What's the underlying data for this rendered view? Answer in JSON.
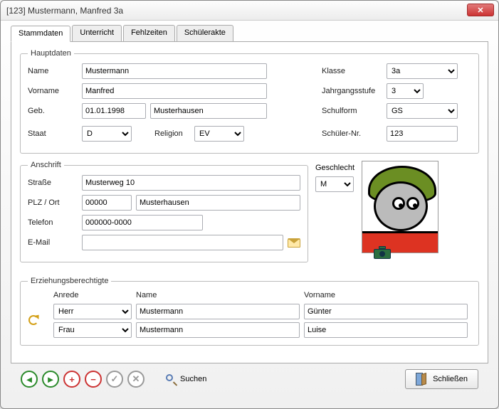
{
  "window": {
    "title": "[123]  Mustermann, Manfred 3a"
  },
  "tabs": {
    "stammdaten": "Stammdaten",
    "unterricht": "Unterricht",
    "fehlzeiten": "Fehlzeiten",
    "schuelerakte": "Schülerakte"
  },
  "hauptdaten": {
    "legend": "Hauptdaten",
    "name_label": "Name",
    "name": "Mustermann",
    "vorname_label": "Vorname",
    "vorname": "Manfred",
    "geb_label": "Geb.",
    "geb": "01.01.1998",
    "geb_ort": "Musterhausen",
    "staat_label": "Staat",
    "staat": "D",
    "religion_label": "Religion",
    "religion": "EV",
    "klasse_label": "Klasse",
    "klasse": "3a",
    "jg_label": "Jahrgangsstufe",
    "jg": "3",
    "schulform_label": "Schulform",
    "schulform": "GS",
    "snr_label": "Schüler-Nr.",
    "snr": "123"
  },
  "anschrift": {
    "legend": "Anschrift",
    "strasse_label": "Straße",
    "strasse": "Musterweg 10",
    "plzort_label": "PLZ / Ort",
    "plz": "00000",
    "ort": "Musterhausen",
    "telefon_label": "Telefon",
    "telefon": "000000-0000",
    "email_label": "E-Mail",
    "email": "",
    "geschlecht_label": "Geschlecht",
    "geschlecht": "M"
  },
  "erz": {
    "legend": "Erziehungsberechtigte",
    "head_anrede": "Anrede",
    "head_name": "Name",
    "head_vorname": "Vorname",
    "rows": [
      {
        "anrede": "Herr",
        "name": "Mustermann",
        "vorname": "Günter"
      },
      {
        "anrede": "Frau",
        "name": "Mustermann",
        "vorname": "Luise"
      }
    ]
  },
  "footer": {
    "search": "Suchen",
    "close": "Schließen"
  }
}
